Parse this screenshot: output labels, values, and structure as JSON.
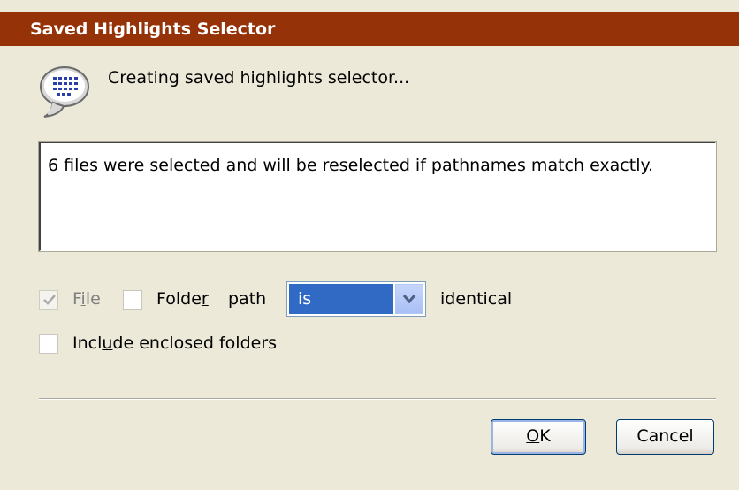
{
  "window": {
    "title": "Saved Highlights Selector"
  },
  "message": {
    "icon": "speech-bubble-icon",
    "text": "Creating saved highlights selector..."
  },
  "details": {
    "text": "6 files were selected and will be reselected if pathnames match exactly."
  },
  "options": {
    "file_checkbox": {
      "label_pre": "F",
      "label_underline": "i",
      "label_post": "le",
      "checked": true,
      "disabled": true
    },
    "folder_checkbox": {
      "label_pre": "Folde",
      "label_underline": "r",
      "label_post": "",
      "checked": false
    },
    "path_label": "path",
    "match_select": {
      "selected": "is"
    },
    "identical_label": "identical",
    "include_enclosed": {
      "label_pre": "Incl",
      "label_underline": "u",
      "label_post": "de enclosed folders",
      "checked": false
    }
  },
  "buttons": {
    "ok": {
      "label_underline": "O",
      "label_post": "K"
    },
    "cancel": {
      "label": "Cancel"
    }
  },
  "colors": {
    "titlebar": "#963208",
    "dialog_bg": "#ece9d8",
    "selection": "#316ac5"
  }
}
